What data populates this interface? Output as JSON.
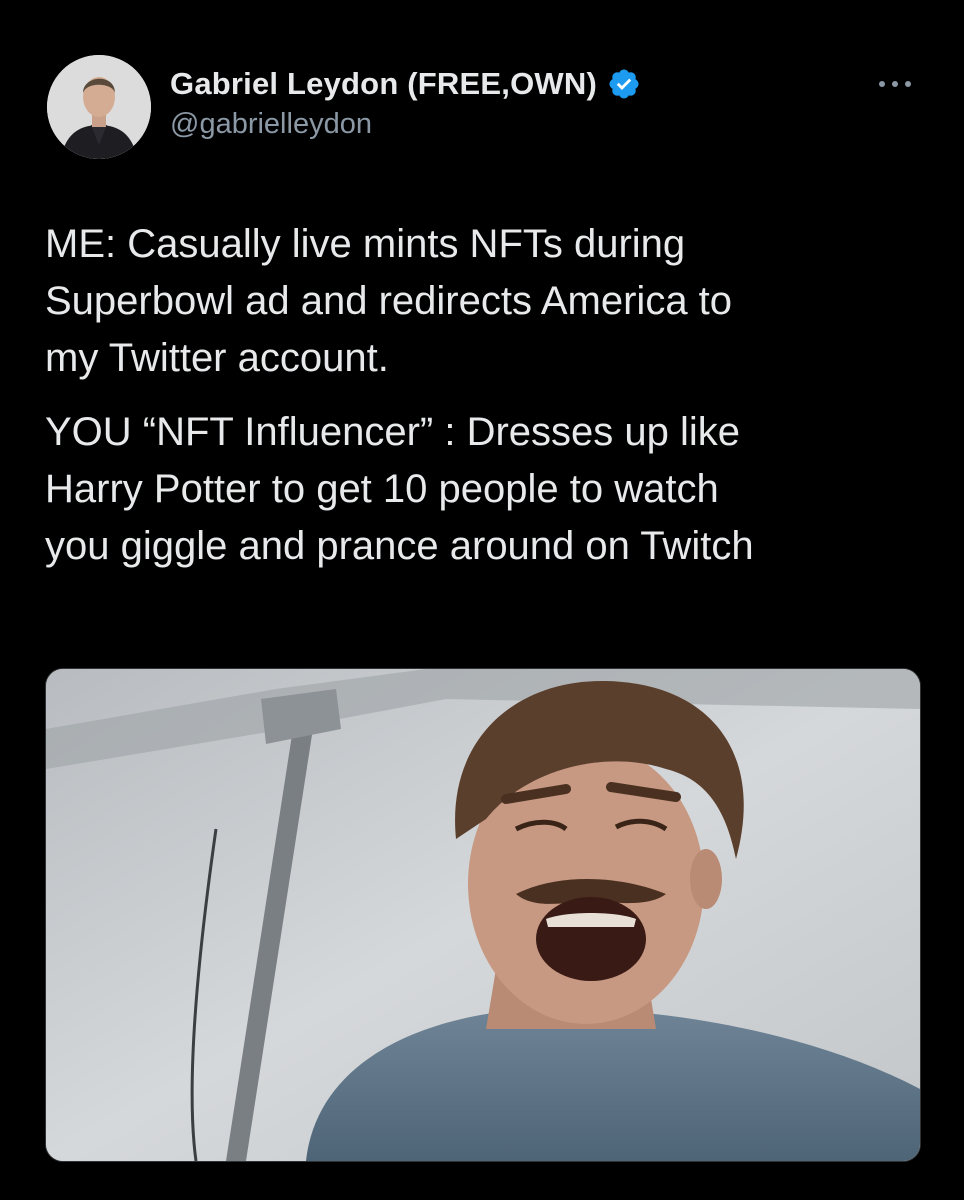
{
  "author": {
    "display_name": "Gabriel Leydon (FREE,OWN)",
    "handle": "@gabrielleydon",
    "verified_icon": "verified-badge-icon",
    "avatar_icon": "profile-photo"
  },
  "tweet": {
    "paragraphs": [
      "ME: Casually live mints NFTs during\nSuperbowl ad and redirects America to\nmy Twitter account.",
      "YOU “NFT Influencer” : Dresses up like\nHarry Potter to get 10 people to watch\nyou giggle and prance around on Twitch"
    ]
  },
  "media": {
    "type": "image",
    "subject": "laughing man in blue t-shirt"
  },
  "colors": {
    "background": "#000000",
    "text": "#e7e9ea",
    "secondary_text": "#8b98a5",
    "verified_blue": "#1d9bf0"
  },
  "icons": {
    "more": "more-options-icon"
  }
}
